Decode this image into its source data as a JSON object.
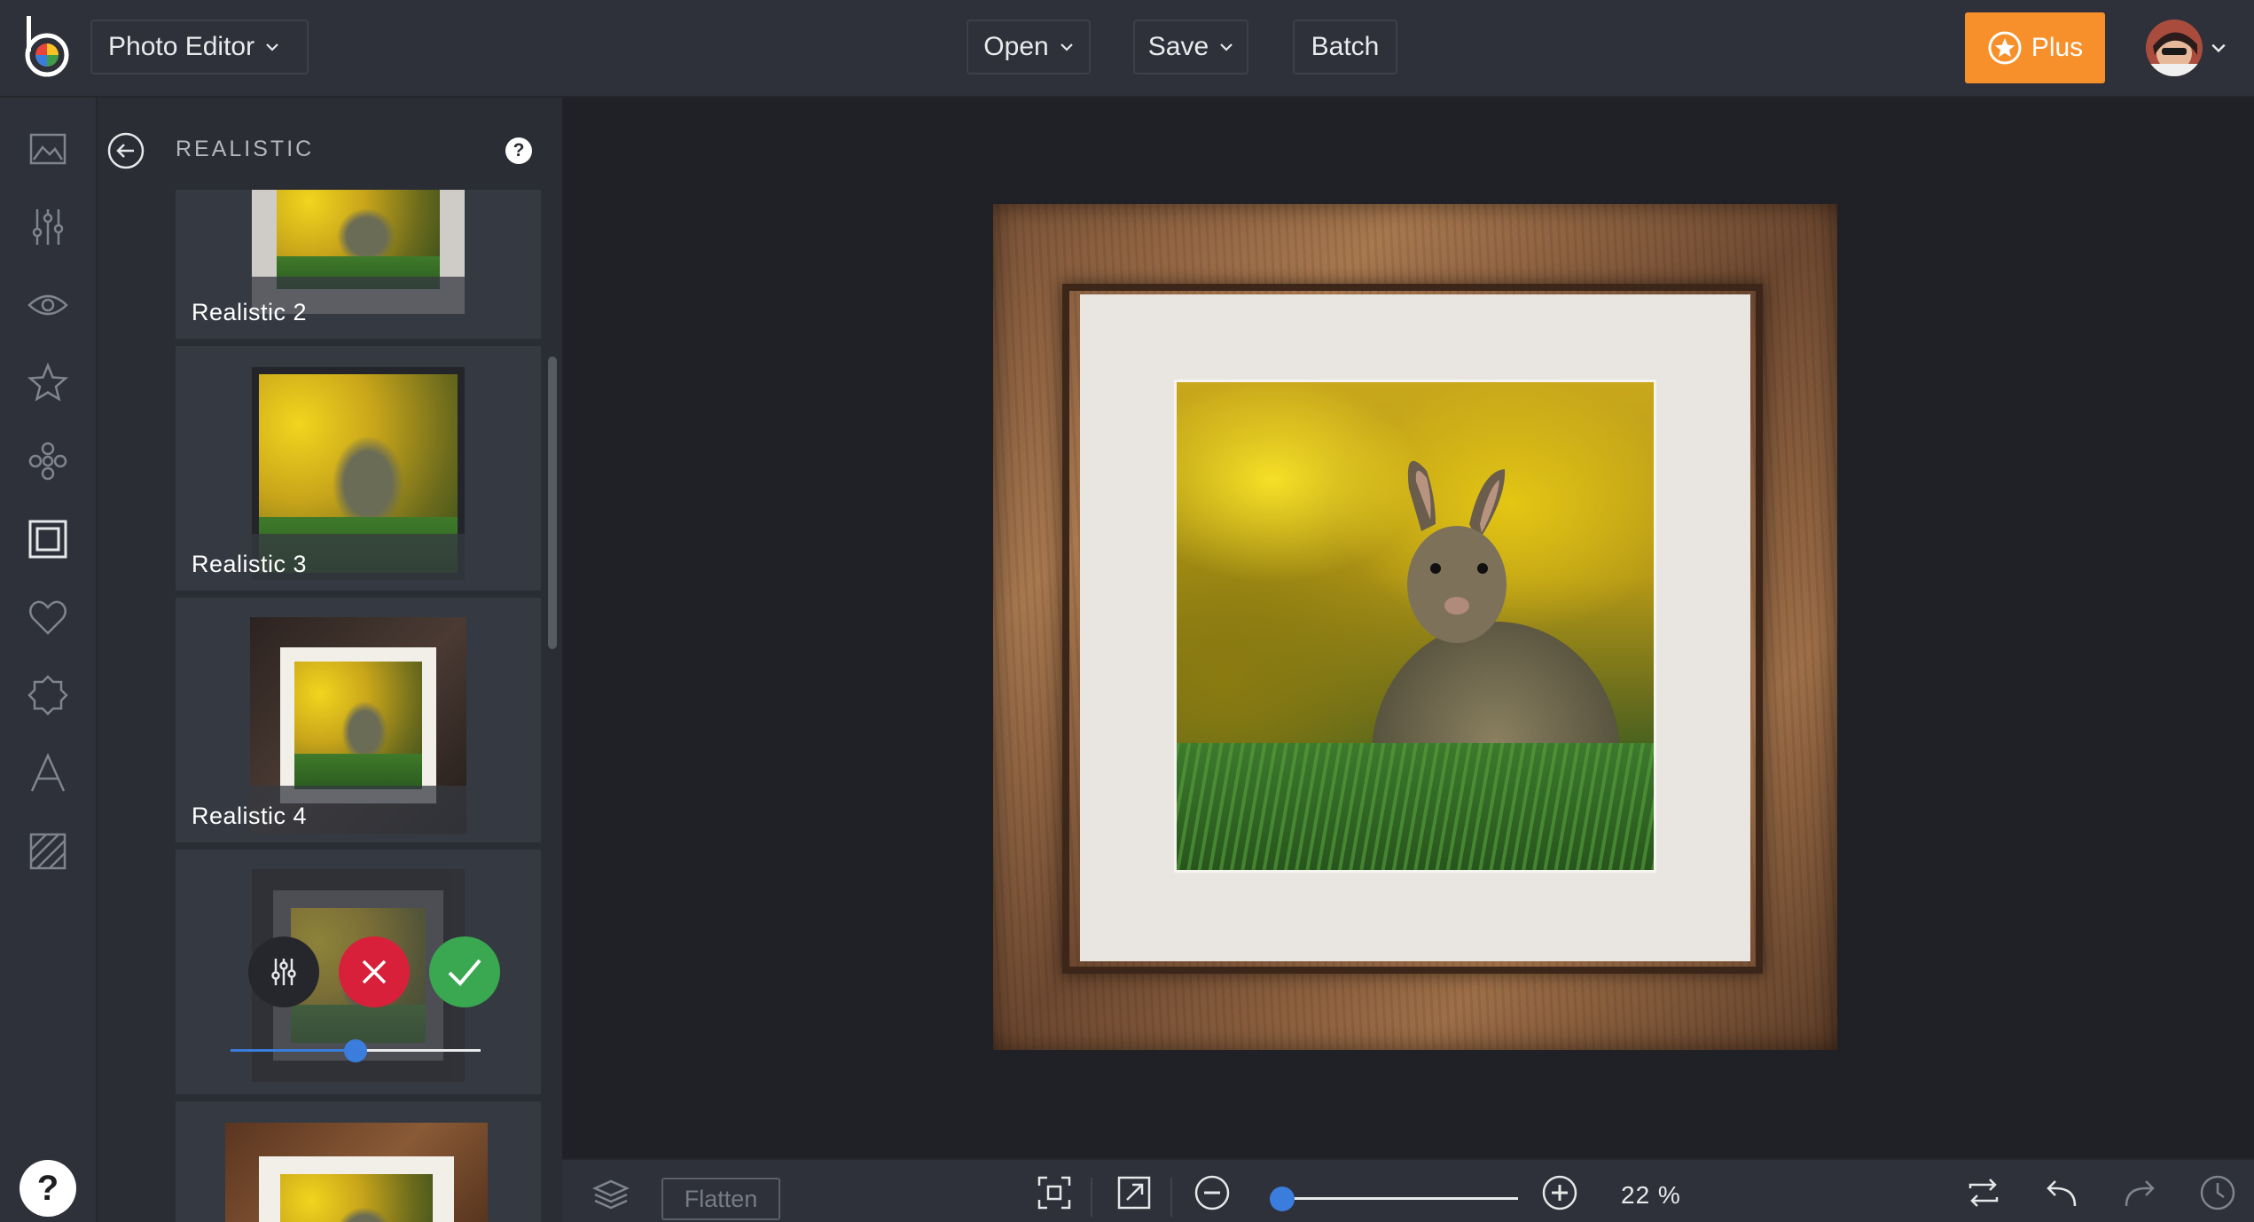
{
  "topbar": {
    "app_menu_label": "Photo Editor",
    "open_label": "Open",
    "save_label": "Save",
    "batch_label": "Batch",
    "plus_label": "Plus"
  },
  "rail": {
    "icons": [
      "image-icon",
      "sliders-icon",
      "eye-icon",
      "star-icon",
      "flower-icon",
      "frame-icon",
      "heart-icon",
      "badge-icon",
      "text-icon",
      "texture-icon"
    ],
    "active": "frame-icon",
    "help_label": "?"
  },
  "panel": {
    "title": "REALISTIC",
    "help_label": "?",
    "cards": [
      {
        "label": "Realistic 2"
      },
      {
        "label": "Realistic 3"
      },
      {
        "label": "Realistic 4"
      },
      {
        "label": ""
      },
      {
        "label": ""
      }
    ],
    "slider_value": 0.5
  },
  "bottombar": {
    "flatten_label": "Flatten",
    "zoom_value": "22 %",
    "zoom_fraction": 0.05
  },
  "colors": {
    "accent_blue": "#3b7ddc",
    "plus_orange": "#f7902a",
    "cancel_red": "#d8203a",
    "apply_green": "#39a851"
  }
}
